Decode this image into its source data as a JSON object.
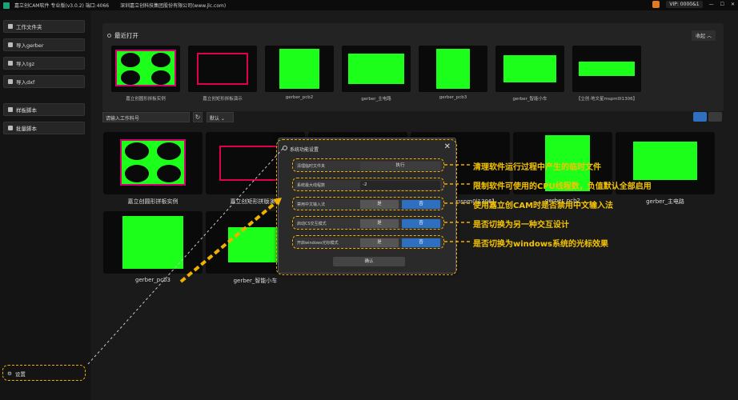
{
  "titlebar": {
    "app_title": "嘉立创CAM软件 专业版(v3.0.2) 端口:4066",
    "company": "深圳嘉立创科技集团股份有限公司(www.jlc.com)",
    "vip": "VIP: 0000&1"
  },
  "sidebar": {
    "items": [
      {
        "label": "工作文件夹"
      },
      {
        "label": "导入gerber"
      },
      {
        "label": "导入tgz"
      },
      {
        "label": "导入dxf"
      },
      {
        "label": "样板脚本"
      },
      {
        "label": "批量脚本"
      }
    ],
    "settings": "设置"
  },
  "recent": {
    "title": "最近打开",
    "collapse": "收起",
    "items": [
      {
        "label": "嘉立创圆形拼板实例"
      },
      {
        "label": "嘉立创矩形拼板演示"
      },
      {
        "label": "gerber_pcb2"
      },
      {
        "label": "gerber_主电路"
      },
      {
        "label": "gerber_pcb3"
      },
      {
        "label": "gerber_智能小车"
      },
      {
        "label": "【立创·地文星mspm0l1306】"
      }
    ]
  },
  "toolbar": {
    "search_placeholder": "请输入工作料号",
    "sort": "默认",
    "refresh_icon": "↻"
  },
  "grid": {
    "items": [
      {
        "label": "嘉立创圆形拼板实例"
      },
      {
        "label": "嘉立创矩形拼版演示"
      },
      {
        "label": "mspm0l1306】"
      },
      {
        "label": "gerber_pcb2"
      },
      {
        "label": "gerber_主电路"
      },
      {
        "label": "gerber_pcb3"
      },
      {
        "label": "gerber_智能小车"
      }
    ]
  },
  "dialog": {
    "title": "系统功能设置",
    "close": "✕",
    "rows": [
      {
        "label": "清理临时文件夹",
        "value": "执行"
      },
      {
        "label": "系统最大线程数",
        "value": "-2"
      },
      {
        "label": "禁用中文输入法",
        "yes": "是",
        "no": "否"
      },
      {
        "label": "启动CS交互模式",
        "yes": "是",
        "no": "否"
      },
      {
        "label": "开启windows光标模式",
        "yes": "是",
        "no": "否"
      }
    ],
    "confirm": "确认"
  },
  "annotations": [
    "清理软件运行过程中产生的临时文件",
    "限制软件可使用的CPU线程数，负值默认全部启用",
    "使用嘉立创CAM时是否禁用中文输入法",
    "是否切换为另一种交互设计",
    "是否切换为windows系统的光标效果"
  ],
  "colors": {
    "accent": "#2f6fbf",
    "pcb_green": "#1bff1b",
    "annotation": "#f0b000"
  }
}
